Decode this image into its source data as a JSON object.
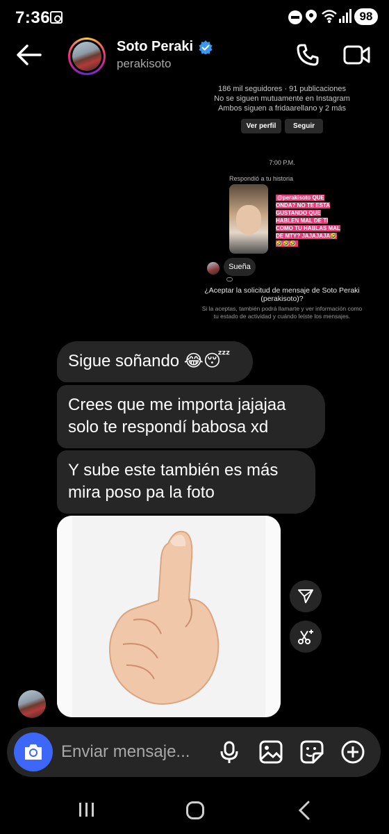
{
  "status_bar": {
    "time": "7:36",
    "battery": "98"
  },
  "header": {
    "name": "Soto Peraki",
    "username": "perakisoto"
  },
  "embedded_screenshot": {
    "stats_line1": "186 mil seguidores · 91 publicaciones",
    "stats_line2": "No se siguen mutuamente en Instagram",
    "stats_line3": "Ambos siguen a fridaarellano y 2 más",
    "view_profile_label": "Ver perfil",
    "follow_label": "Seguir",
    "timestamp": "7:00 P.M.",
    "replied_label": "Respondió a tu historia",
    "story_caption": "@perakisoto QUE ONDA? NO TE ESTA GUSTANDO QUE HABLEN MAL DE TI COMO TU HABLAS MAL DE MTY? JAJAJAJA🤣🤣🤣🤣",
    "reply_bubble": "Sueña",
    "accept_title": "¿Aceptar la solicitud de mensaje de Soto Peraki (perakisoto)?",
    "accept_info": "Si la aceptas, también podrá llamarte y ver información como tu estado de actividad y cuándo leíste los mensajes."
  },
  "messages": [
    {
      "text": "Sigue soñando 😂😴"
    },
    {
      "text": "Crees que me importa jajajaa solo te respondí babosa xd"
    },
    {
      "text": "Y sube este también es más mira poso pa la foto"
    }
  ],
  "composer": {
    "placeholder": "Enviar mensaje..."
  },
  "colors": {
    "background": "#000000",
    "bubble": "#262626",
    "camera_button": "#3d67f6",
    "verified": "#3897f0",
    "story_highlight": "#e8397a"
  }
}
